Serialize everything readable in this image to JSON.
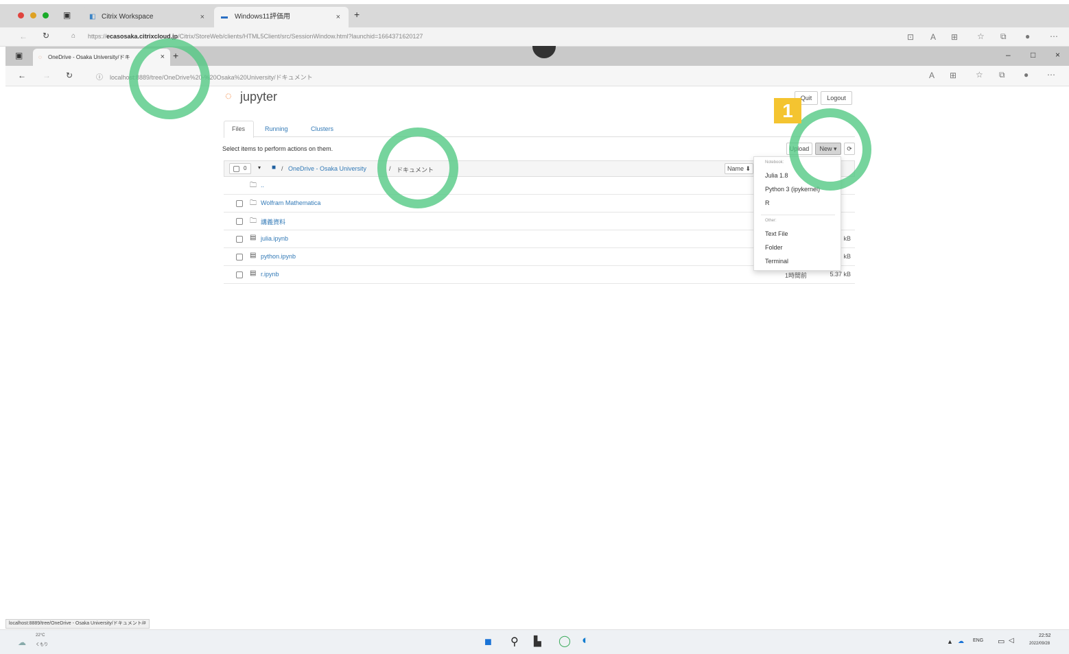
{
  "outer_browser": {
    "tabs": [
      {
        "label": "Citrix Workspace",
        "close": "×"
      },
      {
        "label": "Windows11評価用",
        "close": "×"
      }
    ],
    "new_tab": "+",
    "url_prefix": "https://",
    "url_host": "ecasosaka.citrixcloud.jp",
    "url_path": "/Citrix/StoreWeb/clients/HTML5Client/src/SessionWindow.html?launchid=1664371620127"
  },
  "inner_browser": {
    "tab_label": "OneDrive - Osaka University/ドキ",
    "tab_close": "×",
    "new_tab": "+",
    "url": "localhost:8889/tree/OneDrive%20-%20Osaka%20University/ドキュメント",
    "window_controls": [
      "–",
      "□",
      "×"
    ]
  },
  "jupyter": {
    "logo_text": "jupyter",
    "quit_label": "Quit",
    "logout_label": "Logout",
    "tabs": [
      "Files",
      "Running",
      "Clusters"
    ],
    "instruction": "Select items to perform actions on them.",
    "upload_label": "Upload",
    "new_label": "New ▾",
    "refresh": "⟳",
    "select_count": "0",
    "breadcrumb_root": "/",
    "breadcrumb_folder": "OneDrive - Osaka University",
    "breadcrumb_sep": "/",
    "breadcrumb_current": "ドキュメント",
    "sort_name": "Name ⬇",
    "parent_dir": "..",
    "files": [
      {
        "name": "Wolfram Mathematica",
        "type": "folder",
        "modified": "",
        "size": ""
      },
      {
        "name": "講義資料",
        "type": "folder",
        "modified": "",
        "size": ""
      },
      {
        "name": "julia.ipynb",
        "type": "notebook",
        "modified": "",
        "size": "kB"
      },
      {
        "name": "python.ipynb",
        "type": "notebook",
        "modified": "",
        "size": "kB"
      },
      {
        "name": "r.ipynb",
        "type": "notebook",
        "modified": "1時間前",
        "size": "5.37 kB"
      }
    ]
  },
  "new_menu": {
    "notebook_header": "Notebook:",
    "notebook_items": [
      "Julia 1.8",
      "Python 3 (ipykernel)",
      "R"
    ],
    "other_header": "Other:",
    "other_items": [
      "Text File",
      "Folder",
      "Terminal"
    ]
  },
  "annotation": {
    "badge": "1"
  },
  "status_bar": "localhost:8889/tree/OneDrive - Osaka University/ドキュメント/#",
  "taskbar": {
    "weather_temp": "22°C",
    "weather_desc": "くもり",
    "lang": "ENG",
    "time": "22:52",
    "date": "2022/09/28"
  }
}
